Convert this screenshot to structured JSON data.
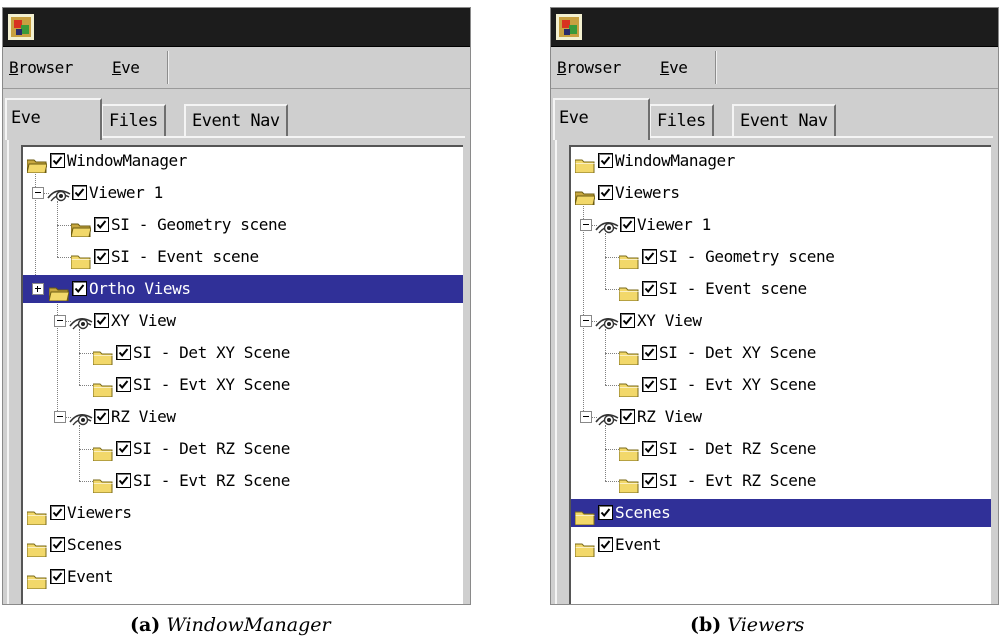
{
  "panels": [
    {
      "menu": {
        "browser": "Browser",
        "eve": "Eve"
      },
      "tabs": [
        "Eve",
        "Files",
        "Event Nav"
      ],
      "tree": [
        {
          "label": "WindowManager",
          "icon": "folder-open-icon",
          "depth": 0
        },
        {
          "label": "Viewer 1",
          "icon": "eye-icon",
          "depth": 1,
          "expander": "minus"
        },
        {
          "label": "SI - Geometry scene",
          "icon": "folder-open-icon",
          "depth": 2
        },
        {
          "label": "SI - Event scene",
          "icon": "folder-icon",
          "depth": 2
        },
        {
          "label": "Ortho Views",
          "icon": "folder-open-icon",
          "depth": 1,
          "expander": "plus",
          "selected": true
        },
        {
          "label": "XY View",
          "icon": "eye-icon",
          "depth": 2,
          "expander": "minus"
        },
        {
          "label": "SI - Det XY Scene",
          "icon": "folder-icon",
          "depth": 3
        },
        {
          "label": "SI - Evt XY Scene",
          "icon": "folder-icon",
          "depth": 3
        },
        {
          "label": "RZ View",
          "icon": "eye-icon",
          "depth": 2,
          "expander": "minus"
        },
        {
          "label": "SI - Det RZ Scene",
          "icon": "folder-icon",
          "depth": 3
        },
        {
          "label": "SI - Evt RZ Scene",
          "icon": "folder-icon",
          "depth": 3
        },
        {
          "label": "Viewers",
          "icon": "folder-icon",
          "depth": 0
        },
        {
          "label": "Scenes",
          "icon": "folder-icon",
          "depth": 0
        },
        {
          "label": "Event",
          "icon": "folder-icon",
          "depth": 0
        }
      ],
      "caption": {
        "letter": "(a)",
        "text": "WindowManager"
      }
    },
    {
      "menu": {
        "browser": "Browser",
        "eve": "Eve"
      },
      "tabs": [
        "Eve",
        "Files",
        "Event Nav"
      ],
      "tree": [
        {
          "label": "WindowManager",
          "icon": "folder-icon",
          "depth": 0
        },
        {
          "label": "Viewers",
          "icon": "folder-open-icon",
          "depth": 0
        },
        {
          "label": "Viewer 1",
          "icon": "eye-icon",
          "depth": 1,
          "expander": "minus"
        },
        {
          "label": "SI - Geometry scene",
          "icon": "folder-icon",
          "depth": 2
        },
        {
          "label": "SI - Event scene",
          "icon": "folder-icon",
          "depth": 2
        },
        {
          "label": "XY View",
          "icon": "eye-icon",
          "depth": 1,
          "expander": "minus"
        },
        {
          "label": "SI - Det XY Scene",
          "icon": "folder-icon",
          "depth": 2
        },
        {
          "label": "SI - Evt XY Scene",
          "icon": "folder-icon",
          "depth": 2
        },
        {
          "label": "RZ View",
          "icon": "eye-icon",
          "depth": 1,
          "expander": "minus"
        },
        {
          "label": "SI - Det RZ Scene",
          "icon": "folder-icon",
          "depth": 2
        },
        {
          "label": "SI - Evt RZ Scene",
          "icon": "folder-icon",
          "depth": 2
        },
        {
          "label": "Scenes",
          "icon": "folder-icon",
          "depth": 0,
          "selected": true
        },
        {
          "label": "Event",
          "icon": "folder-icon",
          "depth": 0
        }
      ],
      "caption": {
        "letter": "(b)",
        "text": "Viewers"
      }
    }
  ],
  "colors": {
    "selection": "#303098",
    "folder": "#f2d86a",
    "titlebar": "#1c1c1c"
  }
}
